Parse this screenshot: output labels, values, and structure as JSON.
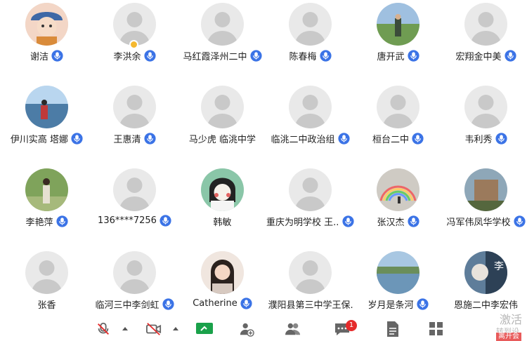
{
  "participants": [
    {
      "name": "谢洁",
      "mic": true,
      "avatar": "cartoon-boy"
    },
    {
      "name": "李洪余",
      "mic": true,
      "avatar": "default",
      "lock": true
    },
    {
      "name": "马红霞泽州二中",
      "mic": true,
      "avatar": "default"
    },
    {
      "name": "陈春梅",
      "mic": true,
      "avatar": "default"
    },
    {
      "name": "唐开武",
      "mic": true,
      "avatar": "outdoor-path"
    },
    {
      "name": "宏翔金中美",
      "mic": true,
      "avatar": "default"
    },
    {
      "name": "伊川实高  塔娜",
      "mic": true,
      "avatar": "lake-photo"
    },
    {
      "name": "王惠清",
      "mic": true,
      "avatar": "default"
    },
    {
      "name": "马少虎 临洮中学",
      "mic": false,
      "avatar": "default"
    },
    {
      "name": "临洮二中政治组",
      "mic": true,
      "avatar": "default"
    },
    {
      "name": "桓台二中",
      "mic": true,
      "avatar": "default"
    },
    {
      "name": "韦利秀",
      "mic": true,
      "avatar": "default"
    },
    {
      "name": "李艳萍",
      "mic": true,
      "avatar": "person-garden"
    },
    {
      "name": "136****7256",
      "mic": true,
      "avatar": "default"
    },
    {
      "name": "韩敏",
      "mic": false,
      "avatar": "cartoon-girl"
    },
    {
      "name": "重庆为明学校 王...",
      "mic": true,
      "avatar": "default"
    },
    {
      "name": "张汉杰",
      "mic": true,
      "avatar": "rainbow"
    },
    {
      "name": "冯军伟凤华学校",
      "mic": true,
      "avatar": "building"
    },
    {
      "name": "张香",
      "mic": false,
      "avatar": "default"
    },
    {
      "name": "临河三中李剑虹",
      "mic": true,
      "avatar": "default"
    },
    {
      "name": "Catherine",
      "mic": true,
      "avatar": "woman-portrait"
    },
    {
      "name": "濮阳县第三中学王保...",
      "mic": false,
      "avatar": "default"
    },
    {
      "name": "岁月是条河",
      "mic": true,
      "avatar": "river"
    },
    {
      "name": "恩施二中李宏伟",
      "mic": false,
      "avatar": "li-portrait",
      "avatar_text": "李"
    }
  ],
  "toolbar": {
    "items": [
      "mic-muted-icon",
      "camera-off-icon",
      "share-screen-icon",
      "add-user-icon",
      "participants-icon",
      "chat-icon",
      "document-icon",
      "apps-grid-icon"
    ],
    "chat_badge": "1"
  },
  "watermark": {
    "line1": "激活",
    "line2": "转到设",
    "leave": "离开会"
  },
  "colors": {
    "mic": "#3b73e6",
    "badge": "#e52b2b",
    "placeholder": "#e8e8e8",
    "silhouette": "#c9c9c9"
  }
}
